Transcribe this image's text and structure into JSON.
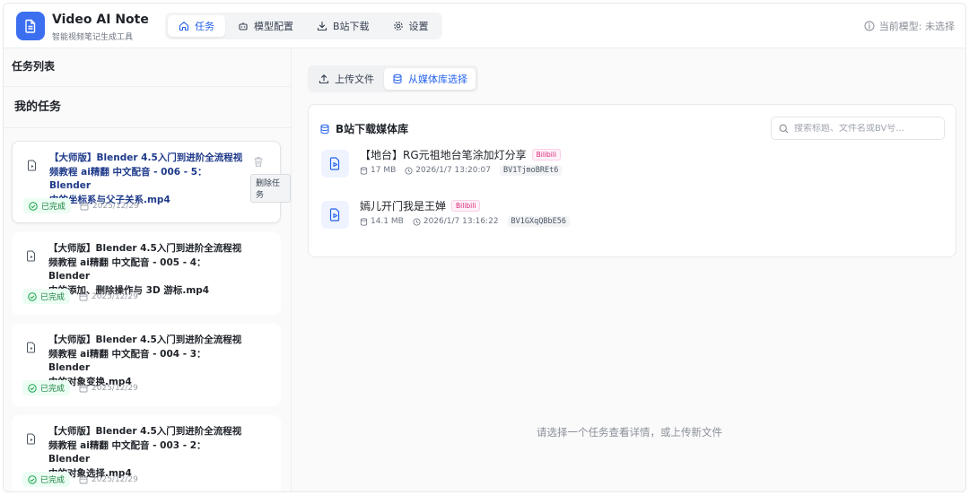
{
  "app": {
    "title": "Video AI Note",
    "subtitle": "智能视频笔记生成工具"
  },
  "nav": {
    "tasks": "任务",
    "model_config": "模型配置",
    "bili_download": "B站下载",
    "settings": "设置"
  },
  "model_status": "当前模型: 未选择",
  "sidebar": {
    "header": "任务列表",
    "my_tasks": "我的任务",
    "tooltip_delete": "删除任务",
    "tasks": [
      {
        "title_lines": [
          "【大师版】Blender 4.5入门到进阶全流程视",
          "频教程 ai精翻 中文配音 - 006 - 5：Blender",
          "中的坐标系与父子关系.mp4"
        ],
        "status": "已完成",
        "date": "2025/12/29"
      },
      {
        "title_lines": [
          "【大师版】Blender 4.5入门到进阶全流程视",
          "频教程 ai精翻 中文配音 - 005 - 4：Blender",
          "中的添加、删除操作与 3D 游标.mp4"
        ],
        "status": "已完成",
        "date": "2025/12/29"
      },
      {
        "title_lines": [
          "【大师版】Blender 4.5入门到进阶全流程视",
          "频教程 ai精翻 中文配音 - 004 - 3：Blender",
          "中的对象变换.mp4"
        ],
        "status": "已完成",
        "date": "2025/12/29"
      },
      {
        "title_lines": [
          "【大师版】Blender 4.5入门到进阶全流程视",
          "频教程 ai精翻 中文配音 - 003 - 2：Blender",
          "中的对象选择.mp4"
        ],
        "status": "已完成",
        "date": "2025/12/29"
      }
    ]
  },
  "main": {
    "tab_upload": "上传文件",
    "tab_library": "从媒体库选择",
    "library_title": "B站下载媒体库",
    "search_placeholder": "搜索标题、文件名或BV号...",
    "items": [
      {
        "title": "【地台】RG元祖地台笔涂加灯分享",
        "badge": "Bilibili",
        "size": "17 MB",
        "time": "2026/1/7 13:20:07",
        "bv": "BV1TjmoBREt6"
      },
      {
        "title": "嫣儿开门我是王婵",
        "badge": "Bilibili",
        "size": "14.1 MB",
        "time": "2026/1/7 13:16:22",
        "bv": "BV1GXqQBbE56"
      }
    ],
    "empty_hint": "请选择一个任务查看详情，或上传新文件"
  },
  "colors": {
    "accent": "#2563eb",
    "logo": "#3b6ff0",
    "success": "#15803d",
    "bilibili": "#db2777"
  }
}
